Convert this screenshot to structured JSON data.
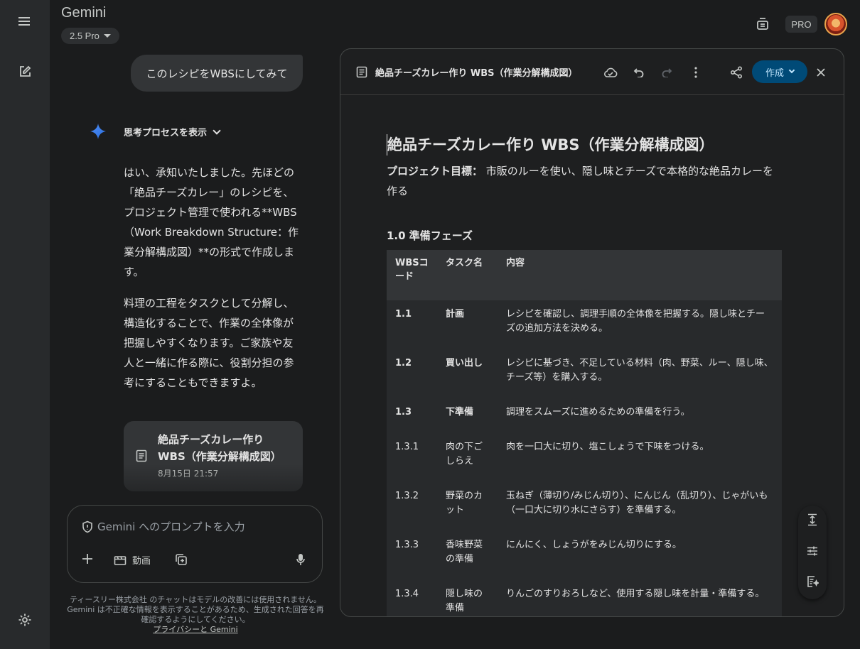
{
  "app": {
    "title": "Gemini",
    "model": "2.5 Pro",
    "badge": "PRO"
  },
  "chat": {
    "user_message": "このレシピをWBSにしてみて",
    "thinking_label": "思考プロセスを表示",
    "reply_paragraphs": [
      "はい、承知いたしました。先ほどの「絶品チーズカレー」のレシピを、プロジェクト管理で使われる**WBS（Work Breakdown Structure：作業分解構成図）**の形式で作成します。",
      "料理の工程をタスクとして分解し、構造化することで、作業の全体像が把握しやすくなります。ご家族や友人と一緒に作る際に、役割分担の参考にすることもできますよ。"
    ],
    "doc_card": {
      "title": "絶品チーズカレー作り WBS（作業分解構成図）",
      "date": "8月15日 21:57"
    }
  },
  "prompt": {
    "placeholder": "Gemini へのプロンプトを入力",
    "video_label": "動画",
    "disclaimer": "ティースリー株式会社 のチャットはモデルの改善には使用されません。Gemini は不正確な情報を表示することがあるため、生成された回答を再確認するようにしてください。",
    "privacy_link": "プライバシーと Gemini"
  },
  "panel": {
    "title": "絶品チーズカレー作り WBS（作業分解構成図）",
    "create_label": "作成",
    "doc_title": "絶品チーズカレー作り WBS（作業分解構成図）",
    "goal_label": "プロジェクト目標：",
    "goal_text": " 市販のルーを使い、隠し味とチーズで本格的な絶品カレーを作る",
    "section_title": "1.0 準備フェーズ",
    "table": {
      "headers": [
        "WBSコード",
        "タスク名",
        "内容"
      ],
      "rows": [
        {
          "code": "1.1",
          "task": "計画",
          "content": "レシピを確認し、調理手順の全体像を把握する。隠し味とチーズの追加方法を決める。",
          "bold": true
        },
        {
          "code": "1.2",
          "task": "買い出し",
          "content": "レシピに基づき、不足している材料（肉、野菜、ルー、隠し味、チーズ等）を購入する。",
          "bold": true
        },
        {
          "code": "1.3",
          "task": "下準備",
          "content": "調理をスムーズに進めるための準備を行う。",
          "bold": true
        },
        {
          "code": "1.3.1",
          "task": "肉の下ごしらえ",
          "content": "肉を一口大に切り、塩こしょうで下味をつける。",
          "bold": false
        },
        {
          "code": "1.3.2",
          "task": "野菜のカット",
          "content": "玉ねぎ（薄切り/みじん切り）、にんじん（乱切り）、じゃがいも（一口大に切り水にさらす）を準備する。",
          "bold": false
        },
        {
          "code": "1.3.3",
          "task": "香味野菜の準備",
          "content": "にんにく、しょうがをみじん切りにする。",
          "bold": false
        },
        {
          "code": "1.3.4",
          "task": "隠し味の準備",
          "content": "りんごのすりおろしなど、使用する隠し味を計量・準備する。",
          "bold": false
        }
      ]
    }
  }
}
